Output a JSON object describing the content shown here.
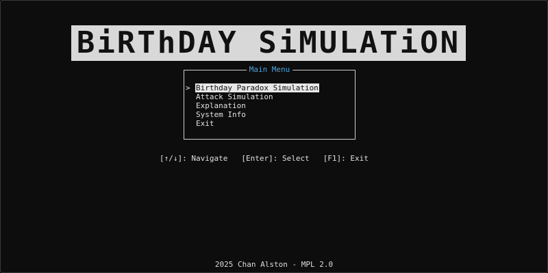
{
  "banner": {
    "title": "BiRThDAY SiMULATiON"
  },
  "menu": {
    "title": "Main Menu",
    "cursor": ">",
    "items": [
      {
        "label": "Birthday Paradox Simulation",
        "selected": true
      },
      {
        "label": "Attack Simulation",
        "selected": false
      },
      {
        "label": "Explanation",
        "selected": false
      },
      {
        "label": "System Info",
        "selected": false
      },
      {
        "label": "Exit",
        "selected": false
      }
    ]
  },
  "hints": [
    {
      "text": "[↑/↓]: Navigate"
    },
    {
      "text": "[Enter]: Select"
    },
    {
      "text": "[F1]: Exit"
    }
  ],
  "footer": {
    "text": "2025 Chan Alston - MPL 2.0"
  },
  "colors": {
    "background": "#0d0d0d",
    "banner_bg": "#d8d8d8",
    "menu_title": "#4fa3e0",
    "selection_bg": "#e8e8e8"
  }
}
